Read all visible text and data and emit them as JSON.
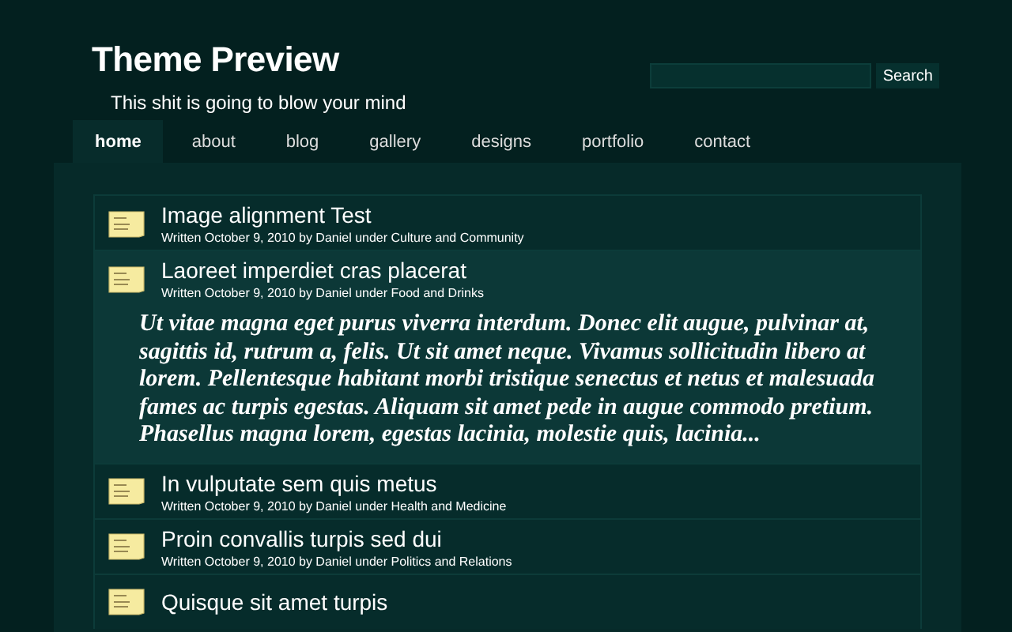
{
  "header": {
    "title": "Theme Preview",
    "tagline": "This shit is going to blow your mind"
  },
  "search": {
    "button": "Search"
  },
  "nav": [
    {
      "label": "home",
      "selected": true
    },
    {
      "label": "about",
      "selected": false
    },
    {
      "label": "blog",
      "selected": false
    },
    {
      "label": "gallery",
      "selected": false
    },
    {
      "label": "designs",
      "selected": false
    },
    {
      "label": "portfolio",
      "selected": false
    },
    {
      "label": "contact",
      "selected": false
    }
  ],
  "posts": [
    {
      "title": "Image alignment Test",
      "meta": "Written October 9, 2010 by Daniel under Culture and Community",
      "expanded": false
    },
    {
      "title": "Laoreet imperdiet cras placerat",
      "meta": "Written October 9, 2010 by Daniel under Food and Drinks",
      "expanded": true,
      "excerpt": "Ut vitae magna eget purus viverra interdum. Donec elit augue, pulvinar at, sagittis id, rutrum a, felis. Ut sit amet neque. Vivamus sollicitudin libero at lorem. Pellentesque habitant morbi tristique senectus et netus et malesuada fames ac turpis egestas. Aliquam sit amet pede in augue commodo pretium. Phasellus magna lorem, egestas lacinia, molestie quis, lacinia..."
    },
    {
      "title": "In vulputate sem quis metus",
      "meta": "Written October 9, 2010 by Daniel under Health and Medicine",
      "expanded": false
    },
    {
      "title": "Proin convallis turpis sed dui",
      "meta": "Written October 9, 2010 by Daniel under Politics and Relations",
      "expanded": false
    },
    {
      "title": "Quisque sit amet turpis",
      "expanded": false
    }
  ]
}
